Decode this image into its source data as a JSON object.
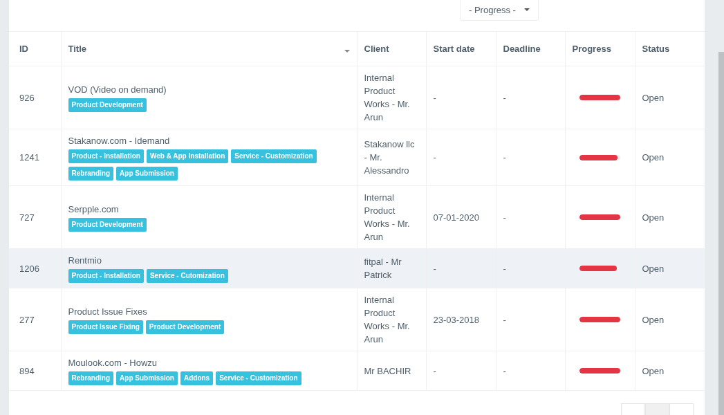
{
  "filter": {
    "label": "- Progress -"
  },
  "table": {
    "columns": [
      {
        "label": "ID",
        "sortable": false
      },
      {
        "label": "Title",
        "sortable": true
      },
      {
        "label": "Client",
        "sortable": false
      },
      {
        "label": "Start date",
        "sortable": false
      },
      {
        "label": "Deadline",
        "sortable": false
      },
      {
        "label": "Progress",
        "sortable": false
      },
      {
        "label": "Status",
        "sortable": false
      }
    ],
    "rows": [
      {
        "id": "926",
        "title": "VOD (Video on demand)",
        "tags": [
          "Product Development"
        ],
        "client": "Internal Product Works - Mr. Arun",
        "start_date": "-",
        "deadline": "-",
        "level": 1,
        "status": "Open",
        "selected": false
      },
      {
        "id": "1241",
        "title": "Stakanow.com - Idemand",
        "tags": [
          "Product - Installation",
          "Web & App Installation",
          "Service - Customization",
          "Rebranding",
          "App Submission"
        ],
        "client": "Stakanow llc - Mr. Alessandro",
        "start_date": "-",
        "deadline": "-",
        "level": 0.94,
        "status": "Open",
        "selected": false
      },
      {
        "id": "727",
        "title": "Serpple.com",
        "tags": [
          "Product Development"
        ],
        "client": "Internal Product Works - Mr. Arun",
        "start_date": "07-01-2020",
        "deadline": "-",
        "level": 1,
        "status": "Open",
        "selected": false
      },
      {
        "id": "1206",
        "title": "Rentmio",
        "tags": [
          "Product - Installation",
          "Service - Cutomization"
        ],
        "client": "fitpal - Mr Patrick",
        "start_date": "-",
        "deadline": "-",
        "level": 0.93,
        "status": "Open",
        "selected": true
      },
      {
        "id": "277",
        "title": "Product Issue Fixes",
        "tags": [
          "Product Issue Fixing",
          "Product Development"
        ],
        "client": "Internal Product Works - Mr. Arun",
        "start_date": "23-03-2018",
        "deadline": "-",
        "level": 1,
        "status": "Open",
        "selected": false
      },
      {
        "id": "894",
        "title": "Moulook.com - Howzu",
        "tags": [
          "Rebranding",
          "App Submission",
          "Addons",
          "Service - Customization"
        ],
        "client": "Mr BACHIR",
        "start_date": "-",
        "deadline": "-",
        "level": 1,
        "status": "Open",
        "selected": false
      }
    ]
  }
}
